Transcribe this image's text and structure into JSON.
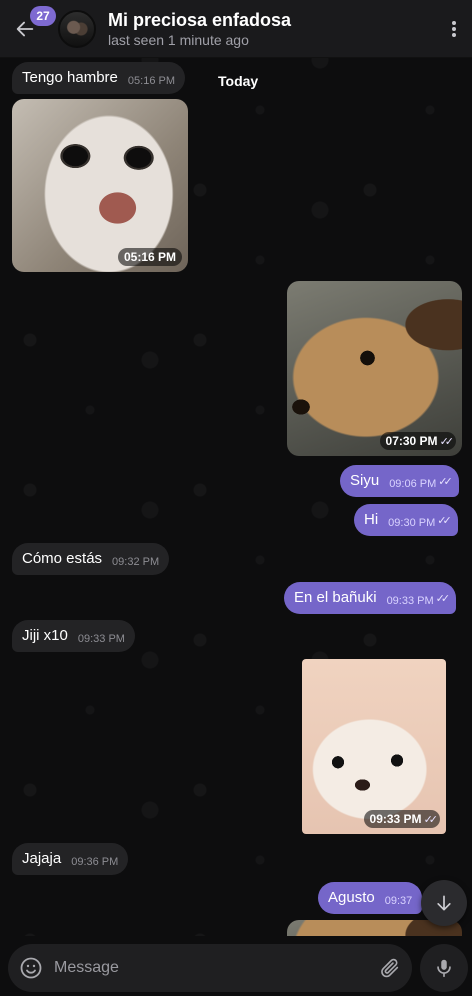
{
  "header": {
    "unread_count": "27",
    "title": "Mi preciosa enfadosa",
    "status": "last seen 1 minute ago"
  },
  "date_separator": "Today",
  "messages": [
    {
      "text": "Tengo hambre",
      "time": "05:16 PM",
      "dir": "in"
    },
    {
      "photo": "cat",
      "time": "05:16 PM",
      "dir": "in"
    },
    {
      "photo": "dog",
      "time": "07:30 PM",
      "dir": "out",
      "read": true
    },
    {
      "text": "Siyu",
      "time": "09:06 PM",
      "dir": "out",
      "read": true
    },
    {
      "text": "Hi",
      "time": "09:30 PM",
      "dir": "out",
      "read": true
    },
    {
      "text": "Cómo estás",
      "time": "09:32 PM",
      "dir": "in"
    },
    {
      "text": "En el bañuki",
      "time": "09:33 PM",
      "dir": "out",
      "read": true
    },
    {
      "text": "Jiji x10",
      "time": "09:33 PM",
      "dir": "in"
    },
    {
      "photo": "chihuahua",
      "time": "09:33 PM",
      "dir": "out",
      "read": true
    },
    {
      "text": "Jajaja",
      "time": "09:36 PM",
      "dir": "in"
    },
    {
      "text": "Agusto",
      "time": "09:37",
      "dir": "out"
    }
  ],
  "read_receipt_icon": "double-check-icon",
  "composer": {
    "placeholder": "Message"
  },
  "colors": {
    "accent": "#7566c9",
    "badge": "#7e6ad1",
    "incoming_bubble": "#232325",
    "header_bg": "#1a1a1c"
  }
}
